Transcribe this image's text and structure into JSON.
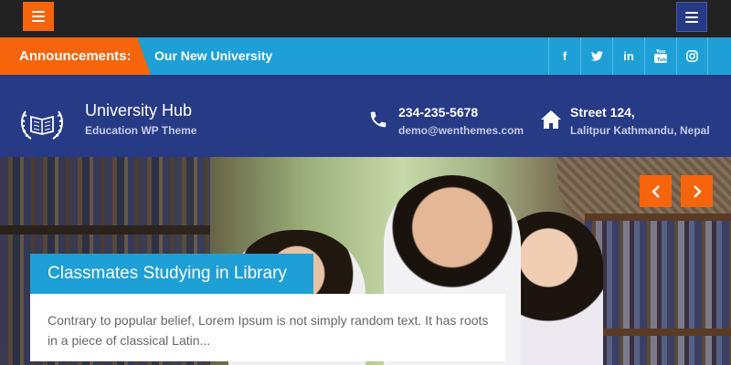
{
  "topbar": {
    "left_menu_icon": "hamburger-icon",
    "right_menu_icon": "hamburger-icon"
  },
  "announcement": {
    "label": "Announcements:",
    "text": "Our New University"
  },
  "social": [
    {
      "name": "facebook",
      "glyph": "f"
    },
    {
      "name": "twitter",
      "glyph": "t"
    },
    {
      "name": "linkedin",
      "glyph": "in"
    },
    {
      "name": "youtube",
      "glyph": "▶"
    },
    {
      "name": "instagram",
      "glyph": "◎"
    }
  ],
  "header": {
    "site_title": "University Hub",
    "site_description": "Education WP Theme",
    "phone": "234-235-5678",
    "email": "demo@wenthemes.com",
    "street": "Street 124,",
    "city": "Lalitpur Kathmandu, Nepal"
  },
  "slider": {
    "caption_title": "Classmates Studying in Library",
    "caption_text": "Contrary to popular belief, Lorem Ipsum is not simply random text. It has roots in a piece of classical Latin...",
    "prev_icon": "chevron-left-icon",
    "next_icon": "chevron-right-icon"
  },
  "colors": {
    "accent_orange": "#f6640b",
    "accent_blue": "#1e9fd6",
    "header_navy": "#273a85",
    "topbar_dark": "#222222"
  }
}
